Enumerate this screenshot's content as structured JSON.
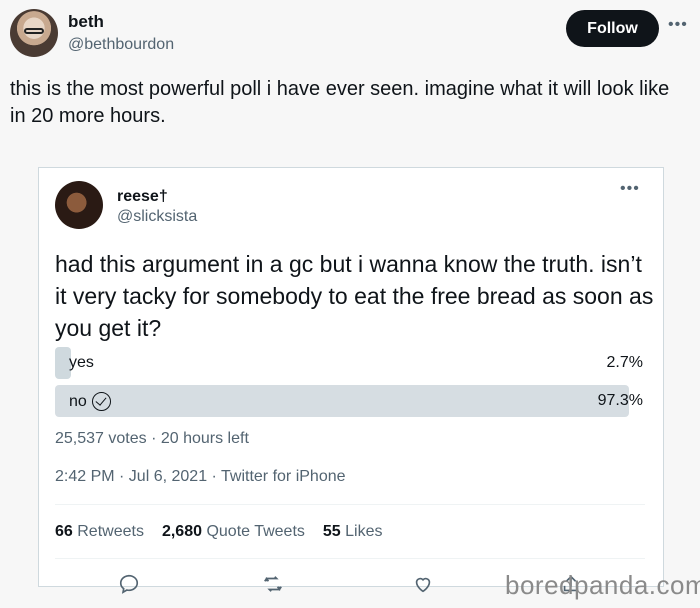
{
  "outer_tweet": {
    "name": "beth",
    "handle": "@bethbourdon",
    "follow_label": "Follow",
    "text": "this is the most powerful poll i have ever seen. imagine what it will look like in 20 more hours."
  },
  "quoted_tweet": {
    "name": "reese†",
    "handle": "@slicksista",
    "text": "had this argument in a gc but i wanna know the truth. isn’t it very tacky for somebody to eat the free bread as soon as you get it?",
    "poll": {
      "options": [
        {
          "label": "yes",
          "percent": "2.7%",
          "share": 0.027,
          "winner": false
        },
        {
          "label": "no",
          "percent": "97.3%",
          "share": 0.973,
          "winner": true
        }
      ],
      "meta": "25,537 votes · 20 hours left"
    },
    "timestamp": "2:42 PM · Jul 6, 2021 · Twitter for iPhone",
    "stats": {
      "retweets_count": "66",
      "retweets_label": "Retweets",
      "quotes_count": "2,680",
      "quotes_label": "Quote Tweets",
      "likes_count": "55",
      "likes_label": "Likes"
    }
  },
  "icons": [
    "more-icon",
    "check-icon",
    "reply-icon",
    "retweet-icon",
    "like-icon",
    "share-icon"
  ],
  "colors": {
    "accent": "#0f1419",
    "muted": "#536471",
    "poll_bar": "#cfd9de"
  },
  "watermark": "boredpanda.com"
}
